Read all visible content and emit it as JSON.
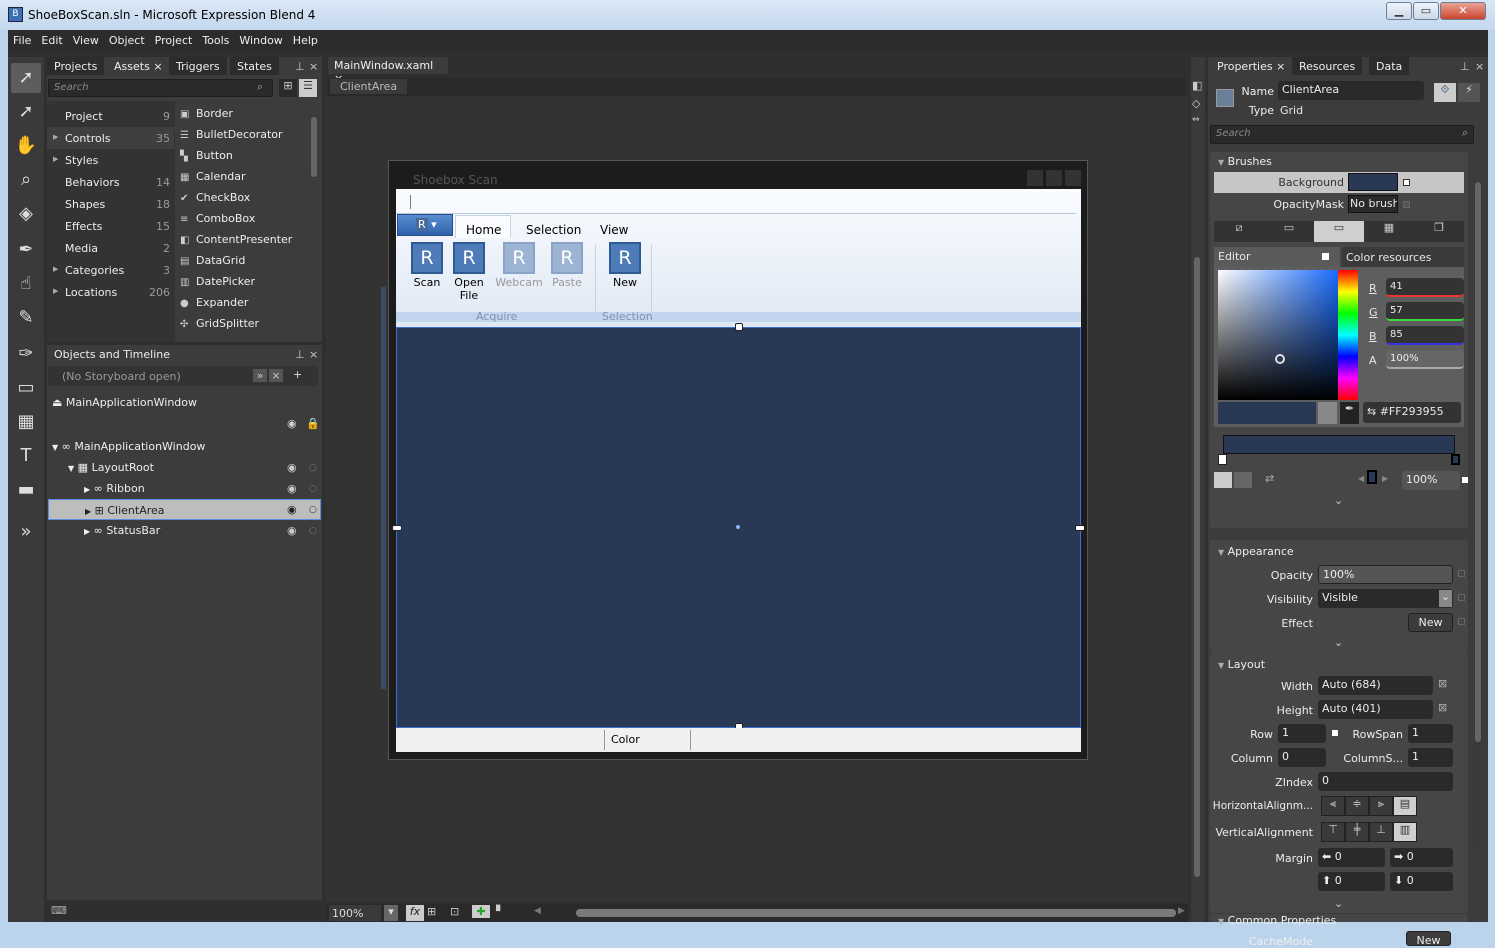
{
  "window": {
    "title": "ShoeBoxScan.sln - Microsoft Expression Blend 4",
    "minimize": "▁",
    "maximize": "▭",
    "close": "✕"
  },
  "menu": [
    "File",
    "Edit",
    "View",
    "Object",
    "Project",
    "Tools",
    "Window",
    "Help"
  ],
  "toolbox": [
    "selection-tool",
    "direct-selection-tool",
    "pan-tool",
    "zoom-tool",
    "camera-orbit-tool",
    "eyedropper-tool",
    "paint-bucket-tool",
    "brush-transform-tool",
    "pen-tool",
    "rectangle-tool",
    "grid-tool",
    "text-tool",
    "button-tool",
    "asset-expander"
  ],
  "assets_panel": {
    "tabs": [
      "Projects",
      "Assets",
      "Triggers",
      "States"
    ],
    "active_tab": "Assets",
    "search_placeholder": "Search",
    "categories": [
      {
        "label": "Project",
        "count": "9"
      },
      {
        "label": "Controls",
        "count": "35"
      },
      {
        "label": "Styles",
        "count": ""
      },
      {
        "label": "Behaviors",
        "count": "14"
      },
      {
        "label": "Shapes",
        "count": "18"
      },
      {
        "label": "Effects",
        "count": "15"
      },
      {
        "label": "Media",
        "count": "2"
      },
      {
        "label": "Categories",
        "count": "3"
      },
      {
        "label": "Locations",
        "count": "206"
      }
    ],
    "items": [
      "Border",
      "BulletDecorator",
      "Button",
      "Calendar",
      "CheckBox",
      "ComboBox",
      "ContentPresenter",
      "DataGrid",
      "DatePicker",
      "Expander",
      "GridSplitter"
    ]
  },
  "objects_panel": {
    "title": "Objects and Timeline",
    "storyboard": "(No Storyboard open)",
    "scope": "MainApplicationWindow",
    "tree": [
      {
        "label": "MainApplicationWindow",
        "level": 0
      },
      {
        "label": "LayoutRoot",
        "level": 1
      },
      {
        "label": "Ribbon",
        "level": 2
      },
      {
        "label": "ClientArea",
        "level": 2,
        "selected": true
      },
      {
        "label": "StatusBar",
        "level": 2
      }
    ]
  },
  "document": {
    "tab": "MainWindow.xaml",
    "breadcrumb": "ClientArea",
    "zoom": "100%",
    "design_window": {
      "title": "Shoebox Scan",
      "app_menu": "R",
      "ribbon_tabs": [
        "Home",
        "Selection",
        "View"
      ],
      "buttons": [
        {
          "label": "Scan",
          "icon": "R",
          "enabled": true
        },
        {
          "label": "Open File",
          "icon": "R",
          "enabled": true
        },
        {
          "label": "Webcam",
          "icon": "R",
          "enabled": false
        },
        {
          "label": "Paste",
          "icon": "R",
          "enabled": false
        },
        {
          "label": "New",
          "icon": "R",
          "enabled": true
        }
      ],
      "groups": [
        "Acquire",
        "Selection"
      ],
      "status": "Color",
      "client_background": "#293955"
    }
  },
  "properties_panel": {
    "tabs": [
      "Properties",
      "Resources",
      "Data"
    ],
    "name_label": "Name",
    "name": "ClientArea",
    "type_label": "Type",
    "type": "Grid",
    "search_placeholder": "Search",
    "brushes": {
      "title": "Brushes",
      "background_label": "Background",
      "opacitymask_label": "OpacityMask",
      "opacitymask_value": "No brush",
      "editor_tab": "Editor",
      "resources_tab": "Color resources",
      "r_label": "R",
      "r": "41",
      "g_label": "G",
      "g": "57",
      "b_label": "B",
      "b": "85",
      "a_label": "A",
      "a": "100%",
      "hex": "#FF293955",
      "stop_offset": "100%"
    },
    "appearance": {
      "title": "Appearance",
      "opacity_label": "Opacity",
      "opacity": "100%",
      "visibility_label": "Visibility",
      "visibility": "Visible",
      "effect_label": "Effect",
      "effect_button": "New"
    },
    "layout": {
      "title": "Layout",
      "width_label": "Width",
      "width": "Auto (684)",
      "height_label": "Height",
      "height": "Auto (401)",
      "row_label": "Row",
      "row": "1",
      "rowspan_label": "RowSpan",
      "rowspan": "1",
      "column_label": "Column",
      "column": "0",
      "columnspan_label": "ColumnS...",
      "columnspan": "1",
      "zindex_label": "ZIndex",
      "zindex": "0",
      "halign_label": "HorizontalAlignm...",
      "valign_label": "VerticalAlignment",
      "margin_label": "Margin",
      "margin_left": "0",
      "margin_right": "0",
      "margin_top": "0",
      "margin_bottom": "0"
    },
    "common": {
      "title": "Common Properties",
      "cachemode_label": "CacheMode",
      "cachemode_button": "New"
    }
  }
}
